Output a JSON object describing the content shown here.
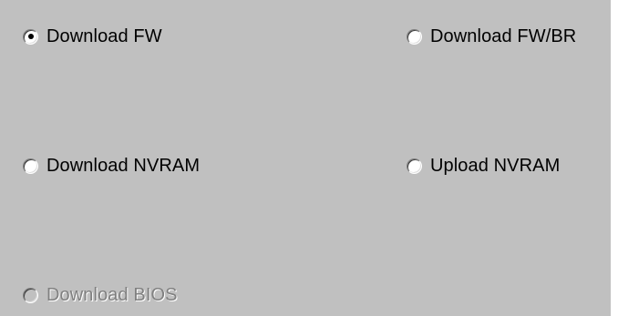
{
  "options": [
    {
      "label": "Download FW",
      "checked": true,
      "enabled": true
    },
    {
      "label": "Download FW/BR",
      "checked": false,
      "enabled": true
    },
    {
      "label": "Download NVRAM",
      "checked": false,
      "enabled": true
    },
    {
      "label": "Upload NVRAM",
      "checked": false,
      "enabled": true
    },
    {
      "label": "Download BIOS",
      "checked": false,
      "enabled": false
    }
  ],
  "colors": {
    "panel_background": "#c0c0c0",
    "text": "#000000",
    "disabled_text": "#808080"
  }
}
